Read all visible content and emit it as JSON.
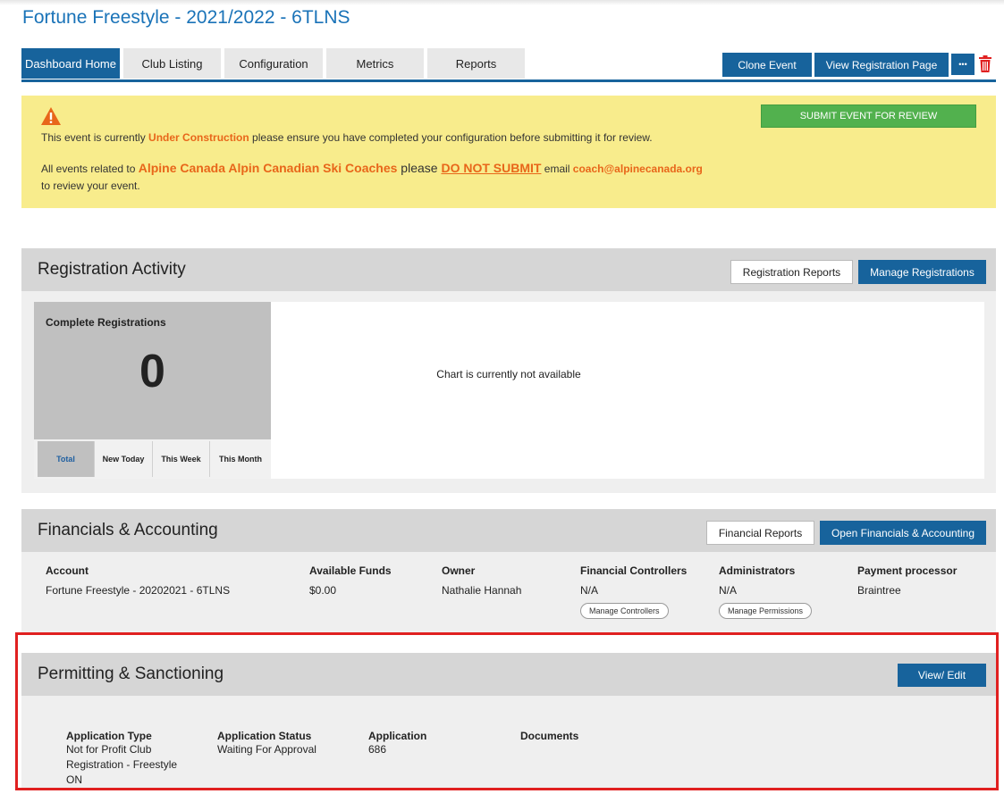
{
  "page": {
    "title": "Fortune Freestyle - 2021/2022 - 6TLNS"
  },
  "tabs": [
    {
      "label": "Dashboard Home"
    },
    {
      "label": "Club Listing"
    },
    {
      "label": "Configuration"
    },
    {
      "label": "Metrics"
    },
    {
      "label": "Reports"
    }
  ],
  "toolbar": {
    "clone_label": "Clone Event",
    "view_reg_label": "View Registration Page",
    "more_label": "•••",
    "delete_icon": "trash-icon"
  },
  "warning": {
    "icon": "warning-triangle-icon",
    "line1_a": "This event is currently ",
    "line1_b": "Under Construction",
    "line1_c": " please ensure you have completed your configuration before submitting it for review.",
    "line2_a": "All events related to ",
    "line2_b": "Alpine Canada Alpin Canadian Ski Coaches",
    "line2_c": " please ",
    "line2_d": "DO NOT SUBMIT",
    "line2_e": " email ",
    "line2_f": "coach@alpinecanada.org",
    "line3": "to review your event.",
    "submit_label": "SUBMIT EVENT FOR REVIEW"
  },
  "registration": {
    "title": "Registration Activity",
    "reports_label": "Registration Reports",
    "manage_label": "Manage Registrations",
    "complete_label": "Complete Registrations",
    "count": "0",
    "periods": [
      "Total",
      "New Today",
      "This Week",
      "This Month"
    ],
    "chart_message": "Chart is currently not available"
  },
  "financials": {
    "title": "Financials & Accounting",
    "reports_label": "Financial Reports",
    "open_label": "Open Financials & Accounting",
    "account_head": "Account",
    "account_val": "Fortune Freestyle - 20202021 - 6TLNS",
    "funds_head": "Available Funds",
    "funds_val": "$0.00",
    "owner_head": "Owner",
    "owner_val": "Nathalie Hannah",
    "controllers_head": "Financial Controllers",
    "controllers_val": "N/A",
    "controllers_btn": "Manage Controllers",
    "admins_head": "Administrators",
    "admins_val": "N/A",
    "admins_btn": "Manage Permissions",
    "processor_head": "Payment processor",
    "processor_val": "Braintree"
  },
  "permitting": {
    "title": "Permitting & Sanctioning",
    "edit_label": "View/ Edit",
    "type_head": "Application Type",
    "type_val": "Not for Profit Club Registration - Freestyle ON",
    "status_head": "Application Status",
    "status_val": "Waiting For Approval",
    "app_head": "Application",
    "app_val": "686",
    "docs_head": "Documents"
  },
  "colors": {
    "primary": "#17639c",
    "title_blue": "#1a73b8",
    "warning_bg": "#f8ec8c",
    "warning_accent": "#e8661a",
    "submit_green": "#52b14e",
    "delete_red": "#e02020",
    "highlight_red": "#e02020"
  }
}
